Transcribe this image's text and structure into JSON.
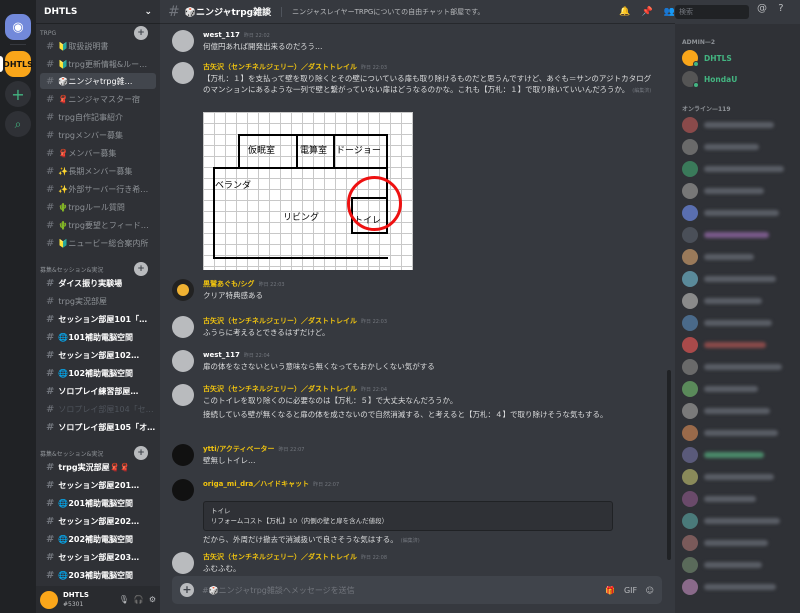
{
  "server": {
    "name": "DHTLS",
    "icon_label": "DHTLS"
  },
  "categories": [
    {
      "label": "TRPG"
    },
    {
      "label": "募集&セッション&実況"
    },
    {
      "label": "募集&セッション&実況"
    }
  ],
  "channels": [
    {
      "label": "🔰取扱説明書"
    },
    {
      "label": "🔰trpg更新情報&ルー…"
    },
    {
      "label": "🎲ニンジャtrpg雑…"
    },
    {
      "label": "🧣ニンジャマスター宿"
    },
    {
      "label": "trpg自作記事紹介"
    },
    {
      "label": "trpgメンバー募集"
    },
    {
      "label": "🧣メンバー募集"
    },
    {
      "label": "✨長期メンバー募集"
    },
    {
      "label": "✨外部サーバー行き希…"
    },
    {
      "label": "🌵trpgルール質問"
    },
    {
      "label": "🌵trpg要望とフィード…"
    },
    {
      "label": "🔰ニュービー総合案内所"
    },
    {
      "label": "ダイス振り実験場"
    },
    {
      "label": "trpg実況部屋"
    },
    {
      "label": "セッション部屋101「…"
    },
    {
      "label": "🌐101補助電脳空間"
    },
    {
      "label": "セッション部屋102…"
    },
    {
      "label": "🌐102補助電脳空間"
    },
    {
      "label": "ソロプレイ練習部屋…"
    },
    {
      "label": "ソロプレイ部屋104「セ…"
    },
    {
      "label": "ソロプレイ部屋105「オ…"
    },
    {
      "label": "trpg実況部屋🧣🧣"
    },
    {
      "label": "セッション部屋201…"
    },
    {
      "label": "🌐201補助電脳空間"
    },
    {
      "label": "セッション部屋202…"
    },
    {
      "label": "🌐202補助電脳空間"
    },
    {
      "label": "セッション部屋203…"
    },
    {
      "label": "🌐203補助電脳空間"
    }
  ],
  "user": {
    "name": "DHTLS",
    "tag": "#5301"
  },
  "header": {
    "channel": "🎲ニンジャtrpg雑談",
    "topic": "ニンジャスレイヤーTRPGについての自由チャット部屋です。"
  },
  "search": {
    "placeholder": "検索"
  },
  "messages": [
    {
      "author": "west_117",
      "time": "昨日 22:02",
      "text": "何億円あれば開発出来るのだろう…"
    },
    {
      "author": "古矢沢（センチネルジェリー）／ダストトレイル",
      "time": "昨日 22:03",
      "text": "【万札：１】を支払って壁を取り除くとその壁についている扉も取り除けるものだと思うんですけど、あぐも＝サンのアジトカタログのマンションにあるような一列で壁と繋がっていない扉はどうなるのかな。これも【万札：１】で取り除いていいんだろうか。",
      "edited": "(編集済)"
    },
    {
      "author": "黒鷲あぐも/シグ",
      "time": "昨日 22:03",
      "text": "クリア特典感ある"
    },
    {
      "author": "古矢沢（センチネルジェリー）／ダストトレイル",
      "time": "昨日 22:03",
      "text": "ふうらに考えるとできるはずだけど。"
    },
    {
      "author": "west_117",
      "time": "昨日 22:04",
      "text": "扉の体をなさないという意味なら無くなってもおかしくない気がする"
    },
    {
      "author": "古矢沢（センチネルジェリー）／ダストトレイル",
      "time": "昨日 22:04",
      "text": "このトイレを取り除くのに必要なのは【万札：５】で大丈夫なんだろうか。",
      "text2": "接続している壁が無くなると扉の体を成さないので自然消滅する、と考えると【万札：４】で取り除けそうな気もする。"
    },
    {
      "author": "ytti/アクティベーター",
      "time": "昨日 22:07",
      "text": "壁無しトイレ…"
    },
    {
      "author": "origa_mi_dra／ハイドキャット",
      "time": "昨日 22:07",
      "embed1": "トイレ",
      "embed2": "リフォームコスト【万札】10（内側の壁と扉を含んだ値段）"
    },
    {
      "author": "",
      "time": "",
      "text": "だから、外周だけ撤去で消滅扱いで良さそうな気はする。",
      "edited": "(編集済)"
    },
    {
      "author": "古矢沢（センチネルジェリー）／ダストトレイル",
      "time": "昨日 22:08",
      "text": "ふむふむ。"
    }
  ],
  "floorplan": {
    "rooms": [
      "仮眠室",
      "電算室",
      "ドージョー",
      "ベランダ",
      "リビング",
      "トイレ"
    ]
  },
  "input": {
    "placeholder": "#🎲ニンジャtrpg雑談へメッセージを送信"
  },
  "members": {
    "admin_header": "ADMIN—2",
    "online_header": "オンライン—119",
    "admins": [
      {
        "name": "DHTLS"
      },
      {
        "name": "HondaU"
      }
    ]
  }
}
